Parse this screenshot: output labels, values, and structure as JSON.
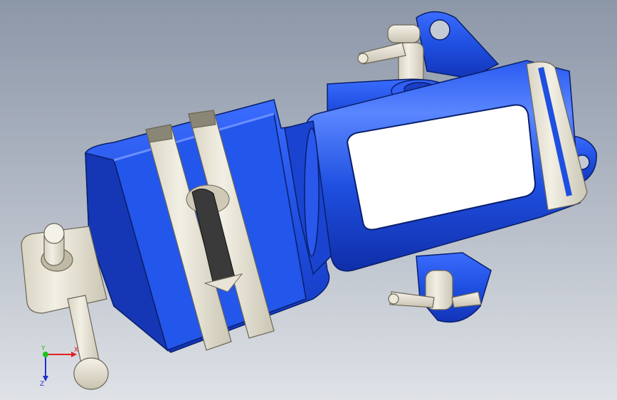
{
  "viewport": {
    "background_top": "#8c97a8",
    "background_bottom": "#dfe2e7"
  },
  "model": {
    "body_color": "#1f4fe0",
    "body_highlight": "#4a7bff",
    "jaw_color": "#ece8da",
    "edge_color": "#0a1f6b"
  },
  "triad": {
    "x_label": "X",
    "y_label": "Y",
    "z_label": "Z",
    "x_color": "#e02020",
    "y_color": "#20c020",
    "z_color": "#2030d0"
  }
}
